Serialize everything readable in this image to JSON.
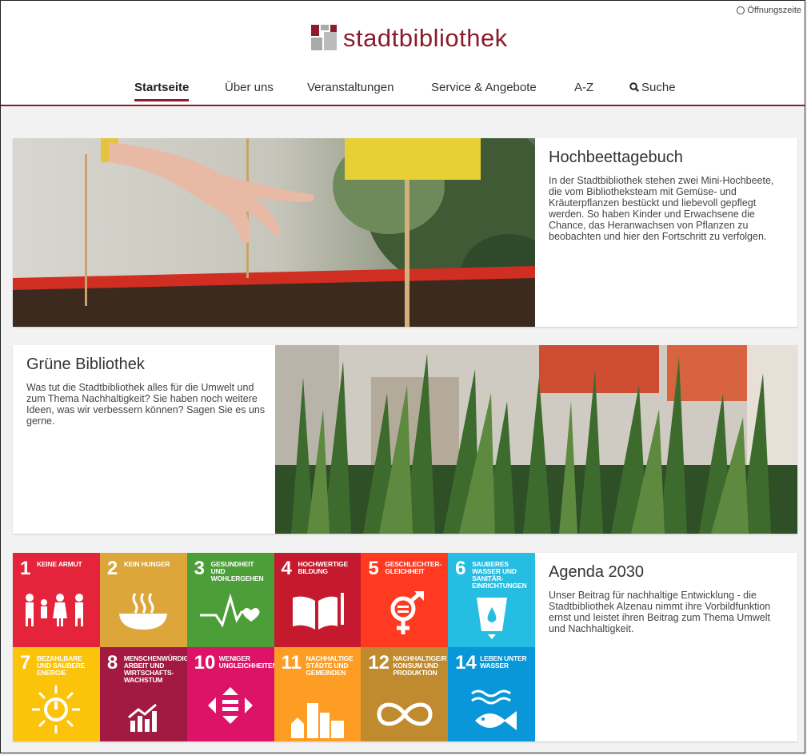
{
  "header": {
    "hours_label": "Öffnungszeite",
    "logo_text": "stadtbibliothek",
    "brand_color": "#8a1c2b",
    "nav": [
      {
        "label": "Startseite",
        "active": true
      },
      {
        "label": "Über uns"
      },
      {
        "label": "Veranstaltungen"
      },
      {
        "label": "Service & Angebote"
      },
      {
        "label": "A-Z"
      },
      {
        "label": "Suche",
        "icon": "search-icon"
      }
    ]
  },
  "cards": [
    {
      "title": "Hochbeettagebuch",
      "text": "In der Stadtbibliothek stehen zwei Mini-Hochbeete, die vom Bibliotheksteam mit Gemüse- und Kräuterpflanzen bestückt und liebevoll gepflegt werden. So haben Kinder und Erwachsene die Chance, das Heranwachsen von Pflanzen zu beobachten und hier den Fortschritt zu verfolgen."
    },
    {
      "title": "Grüne Bibliothek",
      "text": "Was tut die Stadtbibliothek alles für die Umwelt und zum Thema Nachhaltigkeit? Sie haben noch weitere Ideen, was wir verbessern können? Sagen Sie es uns gerne."
    },
    {
      "title": "Agenda 2030",
      "text": "Unser Beitrag für nachhaltige Entwicklung - die Stadtbibliothek Alzenau nimmt ihre Vorbildfunktion ernst und leistet ihren Beitrag zum Thema Umwelt und Nachhaltigkeit."
    }
  ],
  "sdgs": [
    {
      "num": "1",
      "label": "KEINE ARMUT",
      "color": "#e5243b",
      "icon": "family-icon"
    },
    {
      "num": "2",
      "label": "KEIN HUNGER",
      "color": "#dda63a",
      "icon": "bowl-icon"
    },
    {
      "num": "3",
      "label": "GESUNDHEIT UND WOHLERGEHEN",
      "color": "#4c9f38",
      "icon": "heartbeat-icon"
    },
    {
      "num": "4",
      "label": "HOCHWERTIGE BILDUNG",
      "color": "#c5192d",
      "icon": "book-icon"
    },
    {
      "num": "5",
      "label": "GESCHLECHTER-GLEICHHEIT",
      "color": "#ff3a21",
      "icon": "gender-icon"
    },
    {
      "num": "6",
      "label": "SAUBERES WASSER UND SANITÄR-EINRICHTUNGEN",
      "color": "#26bde2",
      "icon": "water-icon"
    },
    {
      "num": "7",
      "label": "BEZAHLBARE UND SAUBERE ENERGIE",
      "color": "#fcc30b",
      "icon": "sun-power-icon"
    },
    {
      "num": "8",
      "label": "MENSCHENWÜRDIGE ARBEIT UND WIRTSCHAFTS-WACHSTUM",
      "color": "#a21942",
      "icon": "growth-chart-icon"
    },
    {
      "num": "10",
      "label": "WENIGER UNGLEICHHEITEN",
      "color": "#dd1367",
      "icon": "equality-icon"
    },
    {
      "num": "11",
      "label": "NACHHALTIGE STÄDTE UND GEMEINDEN",
      "color": "#fd9d24",
      "icon": "city-icon"
    },
    {
      "num": "12",
      "label": "NACHHALTIGE/R KONSUM UND PRODUKTION",
      "color": "#bf8b2e",
      "icon": "infinity-icon"
    },
    {
      "num": "14",
      "label": "LEBEN UNTER WASSER",
      "color": "#0a97d9",
      "icon": "fish-icon"
    }
  ]
}
